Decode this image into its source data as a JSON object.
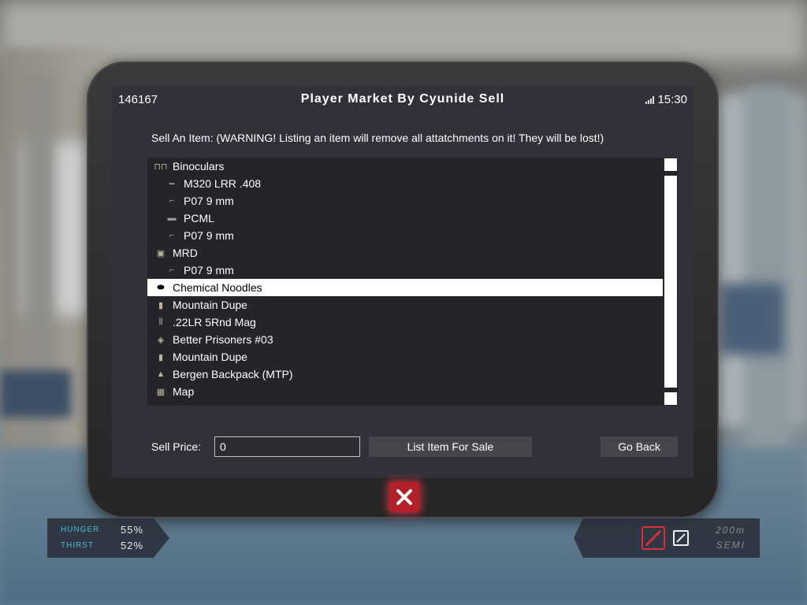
{
  "header": {
    "player_id": "146167",
    "title": "Player Market By Cyunide Sell",
    "time": "15:30"
  },
  "warning": "Sell An Item: (WARNING! Listing an item will remove all attatchments on it! They will be lost!)",
  "items": [
    {
      "label": "Binoculars",
      "icon": "binoculars-icon",
      "indent": false,
      "selected": false
    },
    {
      "label": "M320 LRR .408",
      "icon": "rifle-icon",
      "indent": true,
      "selected": false
    },
    {
      "label": "P07 9 mm",
      "icon": "pistol-icon",
      "indent": true,
      "selected": false
    },
    {
      "label": "PCML",
      "icon": "launcher-icon",
      "indent": true,
      "selected": false
    },
    {
      "label": "P07 9 mm",
      "icon": "pistol-icon",
      "indent": true,
      "selected": false
    },
    {
      "label": "MRD",
      "icon": "rangefinder-icon",
      "indent": false,
      "selected": false
    },
    {
      "label": "P07 9 mm",
      "icon": "pistol-icon",
      "indent": true,
      "selected": false
    },
    {
      "label": "Chemical Noodles",
      "icon": "noodles-icon",
      "indent": false,
      "selected": true
    },
    {
      "label": "Mountain Dupe",
      "icon": "soda-bottle-icon",
      "indent": false,
      "selected": false
    },
    {
      "label": ".22LR 5Rnd Mag",
      "icon": "ammo-icon",
      "indent": false,
      "selected": false
    },
    {
      "label": "Better Prisoners #03",
      "icon": "magazine-icon",
      "indent": false,
      "selected": false
    },
    {
      "label": "Mountain Dupe",
      "icon": "soda-bottle-icon",
      "indent": false,
      "selected": false
    },
    {
      "label": "Bergen Backpack (MTP)",
      "icon": "backpack-icon",
      "indent": false,
      "selected": false
    },
    {
      "label": "Map",
      "icon": "map-icon",
      "indent": false,
      "selected": false
    }
  ],
  "sell": {
    "price_label": "Sell Price:",
    "price_value": "0",
    "list_button": "List Item For Sale",
    "back_button": "Go Back"
  },
  "hud": {
    "hunger_label": "HUNGER",
    "hunger_value": "55%",
    "thirst_label": "THIRST",
    "thirst_value": "52%",
    "zoom": "200m",
    "fire_mode": "SEMI",
    "hunger_color": "#4fb6d8",
    "alert_color": "#d8303a"
  }
}
